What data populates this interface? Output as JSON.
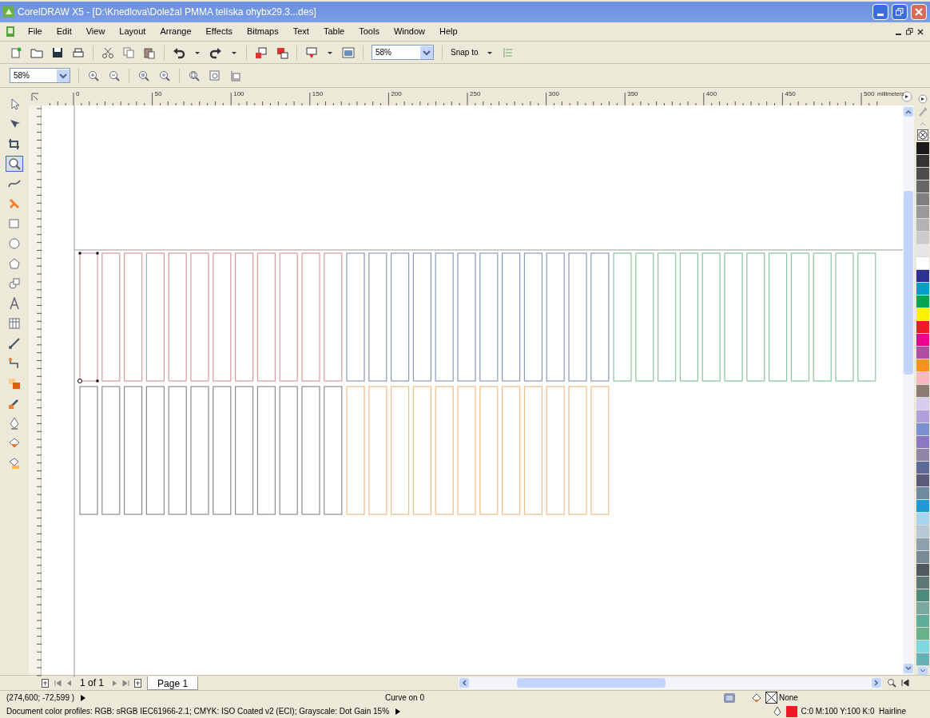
{
  "window": {
    "title": "CorelDRAW X5 - [D:\\Knedlova\\Doležal PMMA telíska ohybx29.3...des]"
  },
  "menu": [
    "File",
    "Edit",
    "View",
    "Layout",
    "Arrange",
    "Effects",
    "Bitmaps",
    "Text",
    "Table",
    "Tools",
    "Window",
    "Help"
  ],
  "toolbar": {
    "zoom": "58%",
    "snap": "Snap to"
  },
  "zoombar": {
    "zoom": "58%"
  },
  "tools": [
    {
      "kind": "pointer",
      "selected": false
    },
    {
      "kind": "shape",
      "selected": false
    },
    {
      "kind": "crop",
      "selected": false
    },
    {
      "kind": "zoom",
      "selected": true
    },
    {
      "kind": "curve",
      "selected": false
    },
    {
      "kind": "smartfill",
      "selected": false
    },
    {
      "kind": "rectangle",
      "selected": false
    },
    {
      "kind": "ellipse",
      "selected": false
    },
    {
      "kind": "polygon",
      "selected": false
    },
    {
      "kind": "shapes",
      "selected": false
    },
    {
      "kind": "text",
      "selected": false
    },
    {
      "kind": "table",
      "selected": false
    },
    {
      "kind": "dimension",
      "selected": false
    },
    {
      "kind": "connector",
      "selected": false
    },
    {
      "kind": "blend",
      "selected": false
    },
    {
      "kind": "eyedropper",
      "selected": false
    },
    {
      "kind": "pen",
      "selected": false
    },
    {
      "kind": "fill",
      "selected": false
    },
    {
      "kind": "interactive",
      "selected": false
    }
  ],
  "ruler": {
    "labels": [
      "0",
      "50",
      "100",
      "150",
      "200",
      "250",
      "300",
      "350",
      "400",
      "450",
      "500"
    ],
    "unit": "millimeters"
  },
  "canvas": {
    "rows": [
      [
        {
          "color": "#d99a9a",
          "selected": true
        },
        {
          "color": "#8a9ab8",
          "selected": false
        },
        {
          "color": "#8cc49c",
          "selected": false
        }
      ],
      [
        {
          "color": "#8c8c8c",
          "selected": false
        },
        {
          "color": "#efbd86",
          "selected": false
        }
      ]
    ]
  },
  "palette": [
    {
      "color": "#1a1a1a"
    },
    {
      "color": "#333333"
    },
    {
      "color": "#4d4d4d"
    },
    {
      "color": "#666666"
    },
    {
      "color": "#808080"
    },
    {
      "color": "#999999"
    },
    {
      "color": "#b3b3b3"
    },
    {
      "color": "#cccccc"
    },
    {
      "color": "#e6e6e6"
    },
    {
      "color": "#ffffff"
    },
    {
      "color": "#2e3192"
    },
    {
      "color": "#00a0c6"
    },
    {
      "color": "#00a651"
    },
    {
      "color": "#fff200"
    },
    {
      "color": "#ed1c24"
    },
    {
      "color": "#ec008c"
    },
    {
      "color": "#b04fa0"
    },
    {
      "color": "#f7941d"
    },
    {
      "color": "#f9b8c0"
    },
    {
      "color": "#8c7b70"
    },
    {
      "color": "#d6ccf0"
    },
    {
      "color": "#b09fd9"
    },
    {
      "color": "#7a90d0"
    },
    {
      "color": "#8c78c0"
    },
    {
      "color": "#8f86a8"
    },
    {
      "color": "#5c6a96"
    },
    {
      "color": "#5a5a7a"
    },
    {
      "color": "#6f8aa0"
    },
    {
      "color": "#1e9ad6"
    },
    {
      "color": "#a6d4ec"
    },
    {
      "color": "#b8c8d4"
    },
    {
      "color": "#8fa0ac"
    },
    {
      "color": "#7a8a94"
    },
    {
      "color": "#505a5e"
    },
    {
      "color": "#5e7874"
    },
    {
      "color": "#4e8a7a"
    },
    {
      "color": "#7aa89c"
    },
    {
      "color": "#60ae9a"
    },
    {
      "color": "#6ab08a"
    },
    {
      "color": "#7fd6dc"
    },
    {
      "color": "#68b0b8"
    }
  ],
  "pages": {
    "counter": "1 of 1",
    "tabs": [
      {
        "label": "Page 1",
        "selected": true
      }
    ]
  },
  "status_bar": {
    "coordinates": "(274,600; -72,599 )",
    "info": "Curve on 0",
    "fill": "None",
    "outline": "C:0 M:100 Y:100 K:0  Hairline",
    "profiles": "Document color profiles: RGB: sRGB IEC61966-2.1; CMYK: ISO Coated v2 (ECI); Grayscale: Dot Gain 15%"
  }
}
